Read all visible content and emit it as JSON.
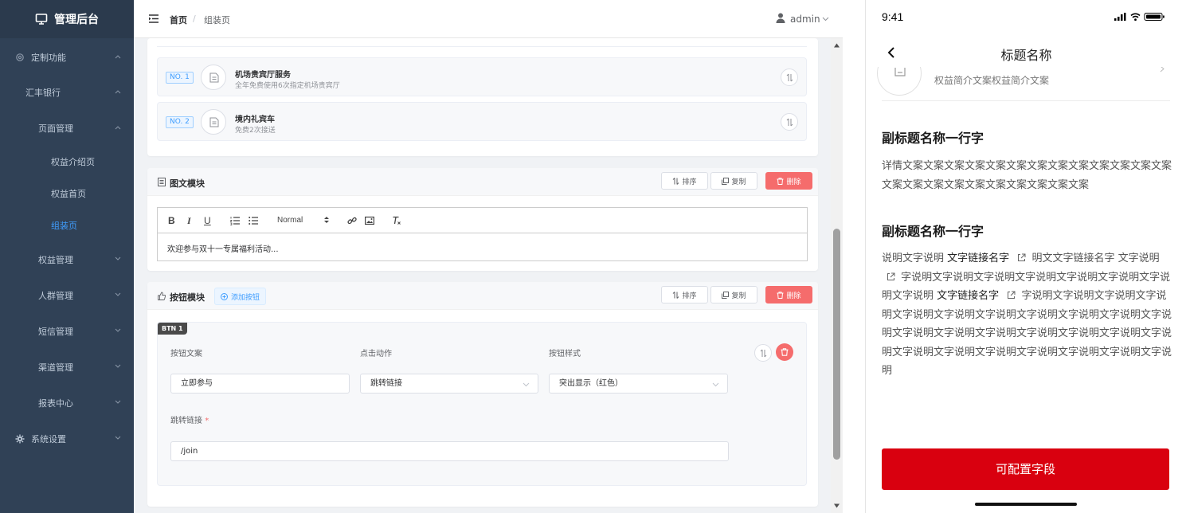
{
  "app": {
    "title": "管理后台"
  },
  "sidebar": {
    "items": [
      {
        "label": "定制功能",
        "icon": "gear-icon"
      },
      {
        "label": "汇丰银行"
      },
      {
        "label": "页面管理"
      },
      {
        "label": "权益介绍页"
      },
      {
        "label": "权益首页"
      },
      {
        "label": "组装页",
        "active": true
      },
      {
        "label": "权益管理"
      },
      {
        "label": "人群管理"
      },
      {
        "label": "短信管理"
      },
      {
        "label": "渠道管理"
      },
      {
        "label": "报表中心"
      },
      {
        "label": "系统设置",
        "icon": "settings-icon"
      }
    ]
  },
  "header": {
    "breadcrumb": {
      "home": "首页",
      "separator": "/",
      "current": "组装页"
    },
    "user": "admin"
  },
  "benefits": [
    {
      "no": "NO. 1",
      "title": "机场贵宾厅服务",
      "desc": "全年免费使用6次指定机场贵宾厅"
    },
    {
      "no": "NO. 2",
      "title": "境内礼宾车",
      "desc": "免费2次接送"
    }
  ],
  "common_actions": {
    "sort": "排序",
    "copy": "复制",
    "delete": "删除"
  },
  "richtext_module": {
    "title": "图文模块",
    "toolbar": {
      "bold": "B",
      "italic": "I",
      "underline": "U",
      "format": "Normal"
    },
    "content": "欢迎参与双十一专属福利活动..."
  },
  "button_module": {
    "title": "按钮模块",
    "add_button": "添加按钮",
    "tag": "BTN 1",
    "labels": {
      "text": "按钮文案",
      "action": "点击动作",
      "style": "按钮样式",
      "link": "跳转链接",
      "required": "*"
    },
    "values": {
      "text": "立即参与",
      "action": "跳转链接",
      "style": "突出显示（红色）",
      "link": "/join"
    }
  },
  "phone": {
    "time": "9:41",
    "nav_title": "标题名称",
    "prev_desc": "权益简介文案权益简介文案",
    "section1": {
      "subtitle": "副标题名称一行字",
      "text": "详情文案文案文案文案文案文案文案文案文案文案文案文案文案文案文案文案文案文案文案文案文案文案文案"
    },
    "section2": {
      "subtitle": "副标题名称一行字",
      "t1": "说明文字说明",
      "link1": "文字链接名字",
      "t2": "明文文字链接名字 文字说明",
      "t3": "字说明文字说明文字说明文字说明文字说明文字说明文字说明文字说明",
      "link2": "文字链接名字",
      "t4": "字说明文字说明文字说明文字说明文字说明文字说明文字说明文字说明文字说明文字说明文字说明文字说明文字说明文字说明文字说明文字说明文字说明文字说明文字说明文字说明文字说明文字说明文字说明文字说明文字说明"
    },
    "cta": "可配置字段"
  },
  "colors": {
    "sidebar": "#304156",
    "accent": "#409eff",
    "danger": "#f56c6c",
    "cta": "#d9000f"
  }
}
